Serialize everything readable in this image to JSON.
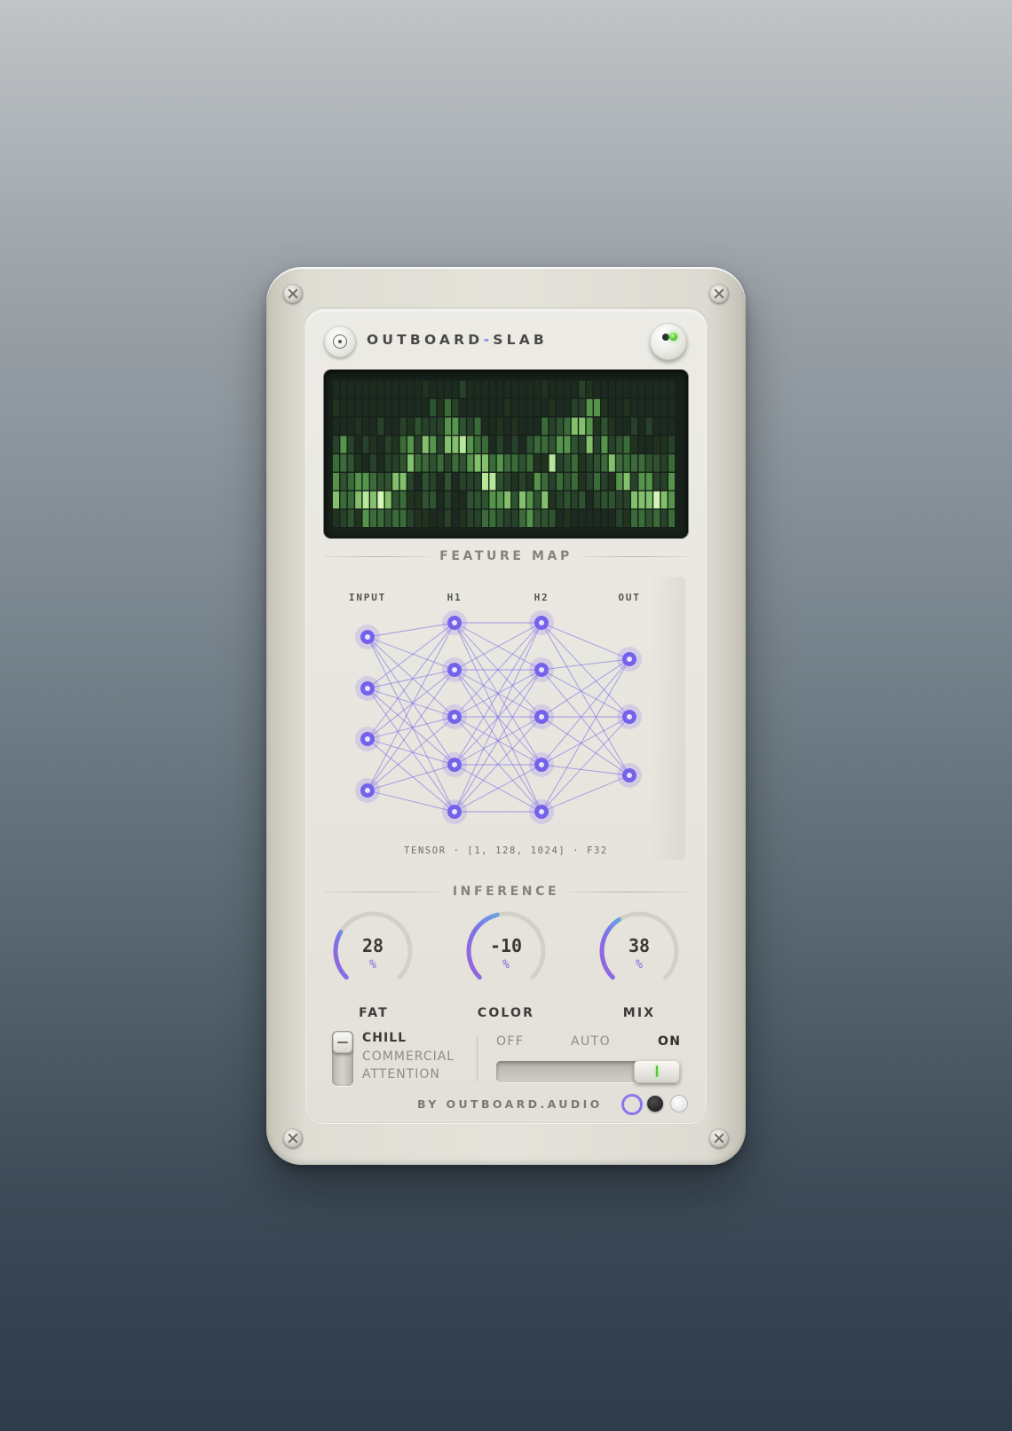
{
  "header": {
    "brand_left": "OUTBOARD",
    "brand_dash": "-",
    "brand_right": "SLAB"
  },
  "icons": {
    "logo": "record-icon",
    "power": "power-led-icon"
  },
  "colors": {
    "accent": "#8b74ef",
    "led_green": "#4fc233",
    "screen_bg": "#17201a"
  },
  "feature_map": {
    "label": "FEATURE MAP",
    "levels": [
      2,
      1,
      4,
      5,
      7,
      7,
      5,
      2,
      6,
      6,
      3,
      3,
      4,
      5,
      6,
      6,
      5,
      3,
      5,
      3,
      5,
      4,
      6,
      6,
      7,
      5,
      3,
      2,
      4,
      5,
      5,
      2,
      4,
      3,
      6,
      4,
      3,
      4,
      2,
      4,
      2,
      2,
      5,
      5,
      4,
      4,
      7,
      6,
      6,
      6,
      5,
      6,
      4,
      5,
      3,
      2,
      5,
      3,
      4,
      5,
      2,
      4,
      3,
      3,
      6,
      6,
      5,
      6,
      7,
      7,
      6,
      6,
      3,
      3,
      5,
      5,
      3,
      5,
      7,
      4,
      2,
      3,
      3,
      4,
      5,
      5,
      6,
      4,
      5,
      5,
      3,
      4,
      4,
      6,
      2,
      4,
      4,
      3,
      4,
      6,
      5,
      4,
      6,
      5,
      5,
      4,
      6,
      4,
      3,
      6,
      3,
      3,
      2,
      5,
      4,
      4,
      3,
      3,
      6,
      6,
      7,
      6,
      6,
      6,
      3,
      4,
      5,
      6,
      7,
      5,
      5,
      6,
      3,
      5,
      3,
      3,
      5,
      3,
      6,
      4,
      4,
      5,
      2,
      5,
      6,
      5,
      5,
      6,
      3,
      6,
      6,
      6,
      4,
      5,
      6,
      3,
      5,
      4,
      7,
      7,
      7,
      5,
      6,
      3,
      6,
      6,
      2,
      2,
      5,
      6,
      6,
      4,
      6,
      4,
      7,
      5,
      4,
      3,
      5,
      6,
      6,
      5,
      4,
      6,
      4,
      6,
      3,
      3,
      4,
      3,
      3,
      4,
      7,
      5,
      6,
      3,
      7,
      3,
      3,
      6,
      2,
      3,
      3,
      2,
      5,
      7,
      7,
      6,
      2,
      4,
      5,
      4,
      7,
      6,
      3,
      3,
      7,
      6,
      4,
      4,
      6,
      6,
      7,
      3,
      5,
      5,
      3,
      5,
      7,
      5,
      4,
      6,
      5,
      2,
      6,
      6,
      5,
      6,
      5,
      5,
      3,
      2,
      4,
      5,
      4,
      4,
      2,
      2,
      2,
      6,
      7,
      7,
      3,
      5,
      5,
      7,
      5,
      7,
      7,
      3,
      5,
      5,
      3,
      3,
      6,
      4,
      5,
      3,
      3,
      4,
      3,
      2,
      4,
      6,
      7,
      6,
      6,
      6,
      5,
      3,
      5,
      3,
      6,
      3,
      2,
      3,
      6,
      5,
      4,
      7,
      4,
      5,
      3,
      3,
      6,
      6,
      4,
      5,
      3,
      3,
      6,
      4,
      5,
      5,
      5,
      5,
      6,
      4,
      5,
      7,
      7,
      6,
      6,
      4,
      7,
      5,
      3,
      4,
      4,
      4,
      7,
      6,
      4,
      5,
      3,
      5,
      2,
      5,
      3,
      3,
      6,
      6,
      6,
      4,
      3,
      6,
      4,
      5,
      6,
      6,
      5,
      4,
      6,
      4,
      3,
      2,
      5,
      5,
      4,
      5,
      3,
      3,
      6,
      5,
      5,
      4,
      3,
      5,
      6,
      6,
      4,
      4,
      3,
      4,
      3,
      6,
      3,
      6,
      3,
      2,
      5,
      6,
      5,
      3,
      3,
      3,
      5,
      4,
      5,
      7,
      6,
      7,
      6,
      6,
      5,
      4,
      5,
      4,
      4,
      5,
      6,
      4,
      5,
      5,
      4,
      6,
      5,
      6,
      6,
      3,
      2,
      5,
      2,
      3,
      4,
      7,
      5,
      6,
      3,
      7,
      7,
      3,
      6,
      6,
      7,
      2,
      3,
      2,
      7,
      4,
      4,
      3,
      5,
      4,
      4,
      6,
      4,
      6,
      2,
      3,
      4,
      6,
      5,
      5,
      3,
      5,
      3,
      2,
      7,
      5,
      3,
      6,
      2,
      6,
      3,
      3,
      5,
      6,
      5,
      4,
      6,
      5,
      4,
      5,
      4,
      3,
      6,
      6,
      7,
      6,
      5,
      2,
      4,
      6,
      3,
      5,
      4,
      6,
      3,
      4,
      3,
      7,
      4,
      5,
      3,
      4,
      5,
      7,
      6,
      3,
      5,
      5,
      4,
      3,
      3,
      6,
      3,
      3,
      6,
      7
    ]
  },
  "network": {
    "layers": [
      {
        "label": "INPUT",
        "nodes": 4
      },
      {
        "label": "H1",
        "nodes": 5
      },
      {
        "label": "H2",
        "nodes": 5
      },
      {
        "label": "OUT",
        "nodes": 3
      }
    ],
    "tensor": "TENSOR · [1, 128, 1024] · F32"
  },
  "inference": {
    "label": "INFERENCE",
    "knobs": [
      {
        "name": "FAT",
        "value": "28",
        "unit": "%",
        "level": 0.28
      },
      {
        "name": "COLOR",
        "value": "-10",
        "unit": "%",
        "level": 0.45
      },
      {
        "name": "MIX",
        "value": "38",
        "unit": "%",
        "level": 0.38
      }
    ]
  },
  "mode": {
    "options": [
      "CHILL",
      "COMMERCIAL",
      "ATTENTION"
    ],
    "selected": "CHILL"
  },
  "tri_switch": {
    "options": [
      "OFF",
      "AUTO",
      "ON"
    ],
    "selected": "ON"
  },
  "footer": {
    "text": "BY OUTBOARD.AUDIO"
  }
}
